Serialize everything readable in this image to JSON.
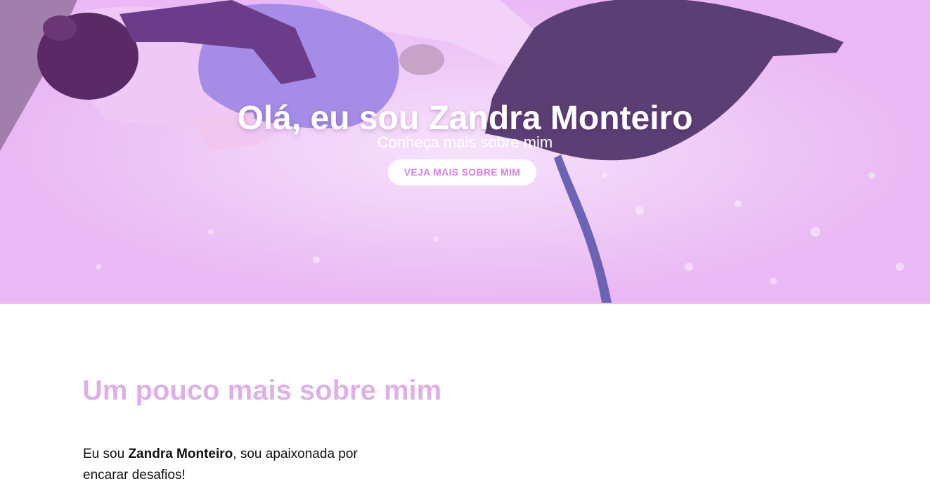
{
  "hero": {
    "title": "Olá, eu sou Zandra Monteiro",
    "subtitle": "Conheça mais sobre mim",
    "button_label": "VEJA MAIS SOBRE MIM"
  },
  "about": {
    "heading": "Um pouco mais sobre mim",
    "text_before": "Eu sou ",
    "name": "Zandra Monteiro",
    "text_after": ", sou apaixonada por encarar desafios!"
  },
  "colors": {
    "hero_overlay": "#e9b6f2",
    "accent_pink": "#d67fe0",
    "heading_lilac": "#deb0e8"
  }
}
